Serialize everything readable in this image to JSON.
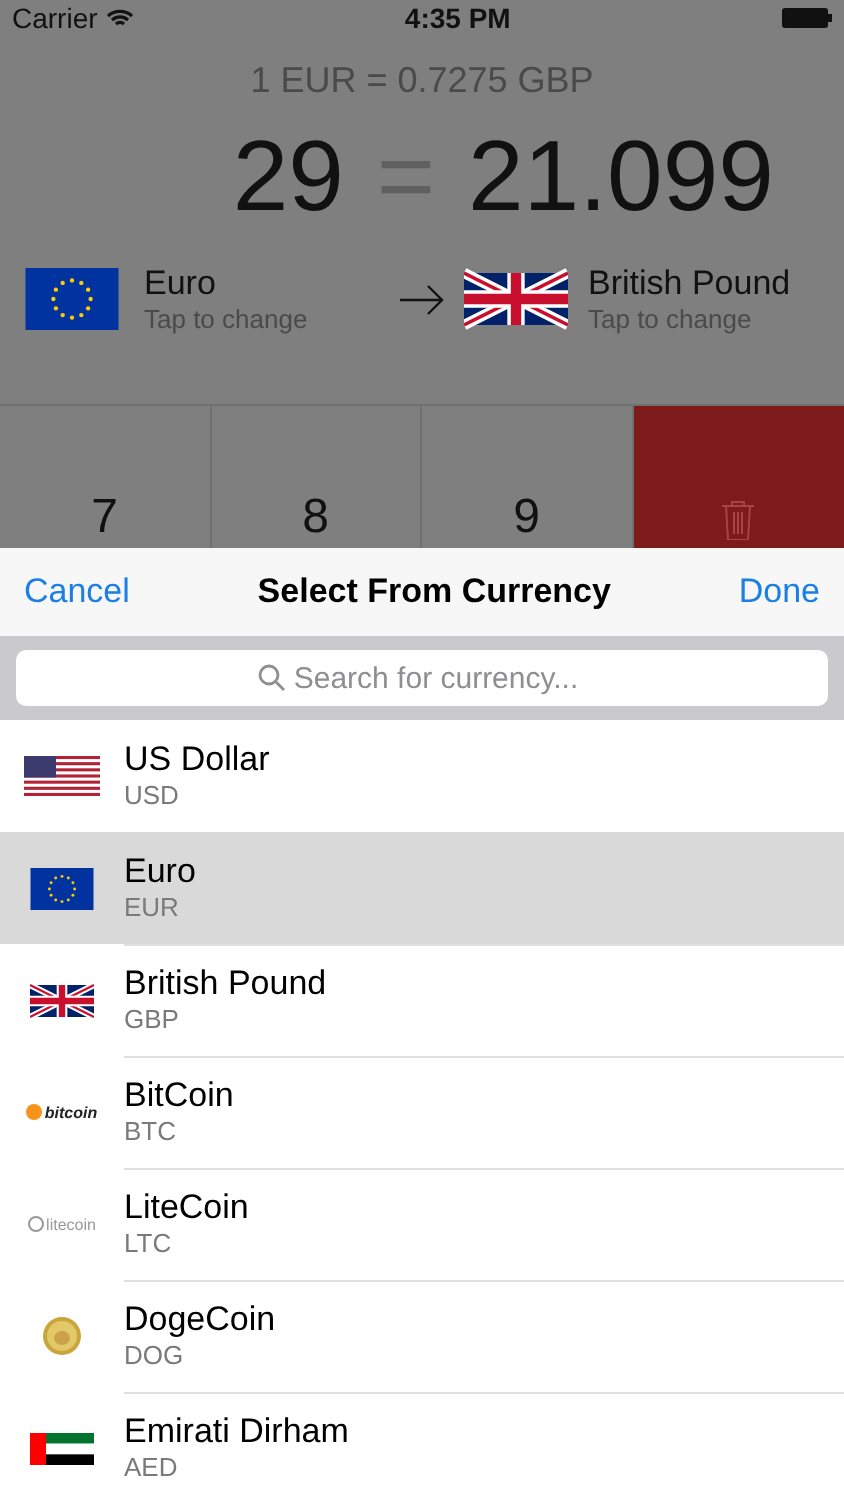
{
  "status_bar": {
    "carrier": "Carrier",
    "time": "4:35 PM"
  },
  "rate": "1 EUR = 0.7275 GBP",
  "amount_from": "29",
  "equals": "=",
  "amount_to": "21.099",
  "from_currency": {
    "kind": "eu",
    "name": "Euro",
    "hint": "Tap to change"
  },
  "to_currency": {
    "kind": "uk",
    "name": "British Pound",
    "hint": "Tap to change"
  },
  "keypad": [
    {
      "kind": "digit",
      "label": "7"
    },
    {
      "kind": "digit",
      "label": "8"
    },
    {
      "kind": "digit",
      "label": "9"
    },
    {
      "kind": "delete"
    }
  ],
  "sheet": {
    "cancel": "Cancel",
    "title": "Select From Currency",
    "done": "Done",
    "search": {
      "placeholder": "Search for currency..."
    }
  },
  "currencies": [
    {
      "kind": "us",
      "name": "US Dollar",
      "code": "USD",
      "selected": false
    },
    {
      "kind": "eu",
      "name": "Euro",
      "code": "EUR",
      "selected": true
    },
    {
      "kind": "uk",
      "name": "British Pound",
      "code": "GBP",
      "selected": false
    },
    {
      "kind": "bitcoin",
      "logo_text": "bitcoin",
      "name": "BitCoin",
      "code": "BTC",
      "selected": false
    },
    {
      "kind": "litecoin",
      "logo_text": "litecoin",
      "name": "LiteCoin",
      "code": "LTC",
      "selected": false
    },
    {
      "kind": "doge",
      "name": "DogeCoin",
      "code": "DOG",
      "selected": false
    },
    {
      "kind": "ae",
      "name": "Emirati Dirham",
      "code": "AED",
      "selected": false
    }
  ]
}
